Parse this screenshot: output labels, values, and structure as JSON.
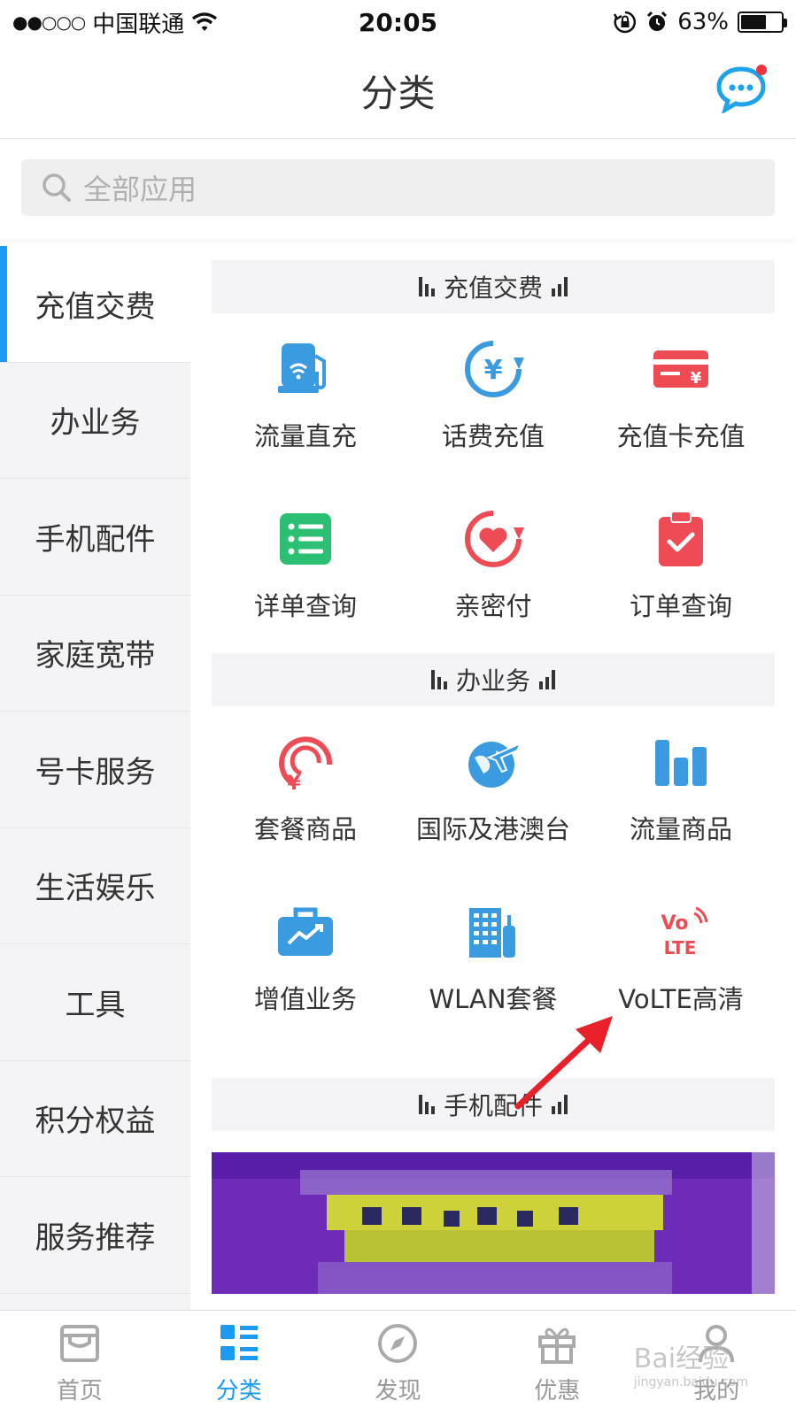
{
  "status_bar": {
    "signal": "●●○○○",
    "carrier": "中国联通",
    "time": "20:05",
    "battery": "63%",
    "battery_level": 0.63
  },
  "nav": {
    "title": "分类"
  },
  "search": {
    "placeholder": "全部应用"
  },
  "sidebar": {
    "items": [
      {
        "label": "充值交费"
      },
      {
        "label": "办业务"
      },
      {
        "label": "手机配件"
      },
      {
        "label": "家庭宽带"
      },
      {
        "label": "号卡服务"
      },
      {
        "label": "生活娱乐"
      },
      {
        "label": "工具"
      },
      {
        "label": "积分权益"
      },
      {
        "label": "服务推荐"
      }
    ],
    "active_index": 0
  },
  "sections": [
    {
      "title": "充值交费",
      "items": [
        {
          "label": "流量直充",
          "icon": "gas-pump-icon",
          "color": "#3b9be0"
        },
        {
          "label": "话费充值",
          "icon": "yuan-refresh-icon",
          "color": "#3b9be0"
        },
        {
          "label": "充值卡充值",
          "icon": "recharge-card-icon",
          "color": "#ef4b55"
        },
        {
          "label": "详单查询",
          "icon": "list-icon",
          "color": "#2bbf73"
        },
        {
          "label": "亲密付",
          "icon": "heart-pay-icon",
          "color": "#ef4b55"
        },
        {
          "label": "订单查询",
          "icon": "clipboard-check-icon",
          "color": "#ef4b55"
        }
      ]
    },
    {
      "title": "办业务",
      "items": [
        {
          "label": "套餐商品",
          "icon": "package-yuan-icon",
          "color": "#ef4b55"
        },
        {
          "label": "国际及港澳台",
          "icon": "globe-plane-icon",
          "color": "#3b9be0"
        },
        {
          "label": "流量商品",
          "icon": "bar-chart-icon",
          "color": "#3b9be0"
        },
        {
          "label": "增值业务",
          "icon": "briefcase-trend-icon",
          "color": "#3b9be0"
        },
        {
          "label": "WLAN套餐",
          "icon": "building-icon",
          "color": "#3b9be0"
        },
        {
          "label": "VoLTE高清",
          "icon": "volte-icon",
          "color": "#ef4b55"
        }
      ]
    },
    {
      "title": "手机配件",
      "items": []
    }
  ],
  "tab_bar": {
    "items": [
      {
        "label": "首页",
        "icon": "home-store-icon"
      },
      {
        "label": "分类",
        "icon": "category-list-icon"
      },
      {
        "label": "发现",
        "icon": "compass-icon"
      },
      {
        "label": "优惠",
        "icon": "gift-icon"
      },
      {
        "label": "我的",
        "icon": "user-icon"
      }
    ],
    "active_index": 1
  },
  "watermark": {
    "text": "Bai经验",
    "subtext": "jingyan.baidu.com"
  },
  "colors": {
    "accent": "#1a9af0",
    "red": "#ef4b55",
    "arrow": "#e8202a"
  }
}
